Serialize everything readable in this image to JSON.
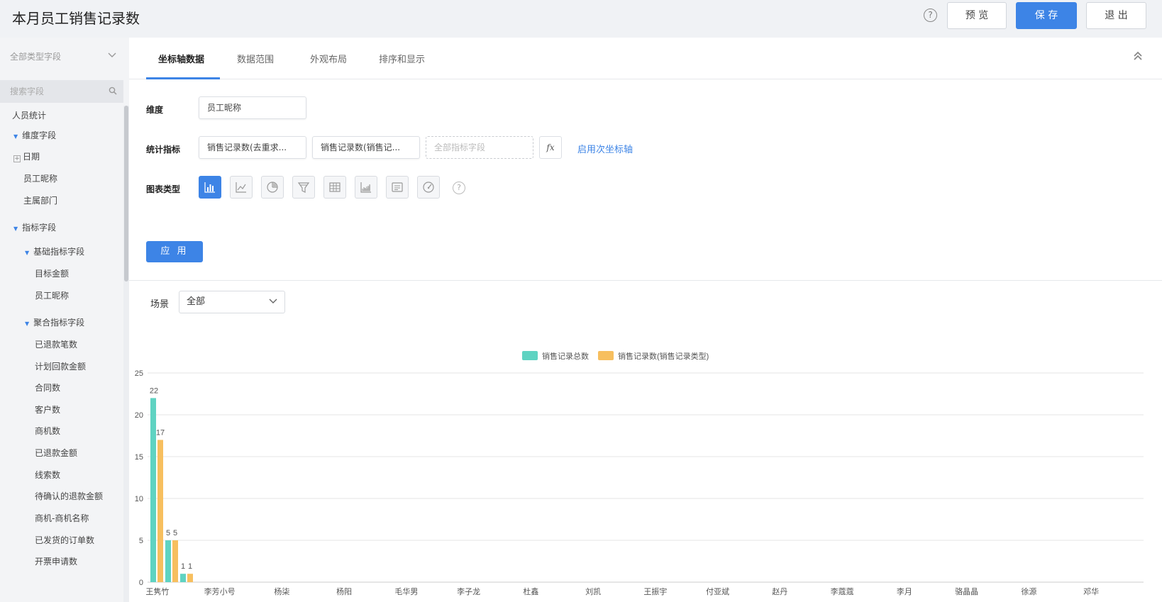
{
  "header": {
    "title": "本月员工销售记录数",
    "help": "?",
    "preview_label": "预 览",
    "save_label": "保 存",
    "exit_label": "退 出"
  },
  "sidebar": {
    "field_type_select": "全部类型字段",
    "search_placeholder": "搜索字段",
    "tree": [
      {
        "label": "人员统计"
      },
      {
        "label": "维度字段"
      },
      {
        "label": "日期"
      },
      {
        "label": "员工昵称"
      },
      {
        "label": "主属部门"
      },
      {
        "label": "指标字段"
      },
      {
        "label": "基础指标字段"
      },
      {
        "label": "目标金额"
      },
      {
        "label": "员工昵称"
      },
      {
        "label": "聚合指标字段"
      },
      {
        "label": "已退款笔数"
      },
      {
        "label": "计划回款金额"
      },
      {
        "label": "合同数"
      },
      {
        "label": "客户数"
      },
      {
        "label": "商机数"
      },
      {
        "label": "已退款金额"
      },
      {
        "label": "线索数"
      },
      {
        "label": "待确认的退款金额"
      },
      {
        "label": "商机-商机名称"
      },
      {
        "label": "已发货的订单数"
      },
      {
        "label": "开票申请数"
      }
    ]
  },
  "tabs": [
    {
      "label": "坐标轴数据"
    },
    {
      "label": "数据范围"
    },
    {
      "label": "外观布局"
    },
    {
      "label": "排序和显示"
    }
  ],
  "config": {
    "dimension_label": "维度",
    "dimension_value": "员工昵称",
    "metrics_label": "统计指标",
    "metric_1": "销售记录数(去重求...",
    "metric_2": "销售记录数(销售记...",
    "metric_placeholder": "全部指标字段",
    "fx_label": "fx",
    "secondary_axis_link": "启用次坐标轴",
    "chart_type_label": "图表类型",
    "chart_types": [
      "bar-chart-icon",
      "line-chart-icon",
      "pie-chart-icon",
      "funnel-chart-icon",
      "table-icon",
      "area-chart-icon",
      "text-card-icon",
      "gauge-icon"
    ],
    "help": "?",
    "apply_label": "应 用"
  },
  "scene": {
    "label": "场景",
    "value": "全部"
  },
  "colors": {
    "accent": "#3d84e6",
    "series1": "#5fd3c2",
    "series2": "#f7bf5f"
  },
  "chart_data": {
    "type": "bar",
    "categories": [
      "王隽竹",
      "李芳小号",
      "杨柒",
      "杨阳",
      "毛华男",
      "李子龙",
      "杜鑫",
      "刘凯",
      "王振宇",
      "付亚斌",
      "赵丹",
      "李蔻蔻",
      "李月",
      "骆晶晶",
      "徐源",
      "邓华"
    ],
    "series": [
      {
        "name": "销售记录总数",
        "values": [
          22,
          5,
          1
        ]
      },
      {
        "name": "销售记录数(销售记录类型)",
        "values": [
          17,
          5,
          1
        ]
      }
    ],
    "ylim": [
      0,
      25
    ],
    "yticks": [
      "0",
      "5",
      "10",
      "15",
      "20",
      "25"
    ],
    "legend": "top-center",
    "grid": true
  }
}
